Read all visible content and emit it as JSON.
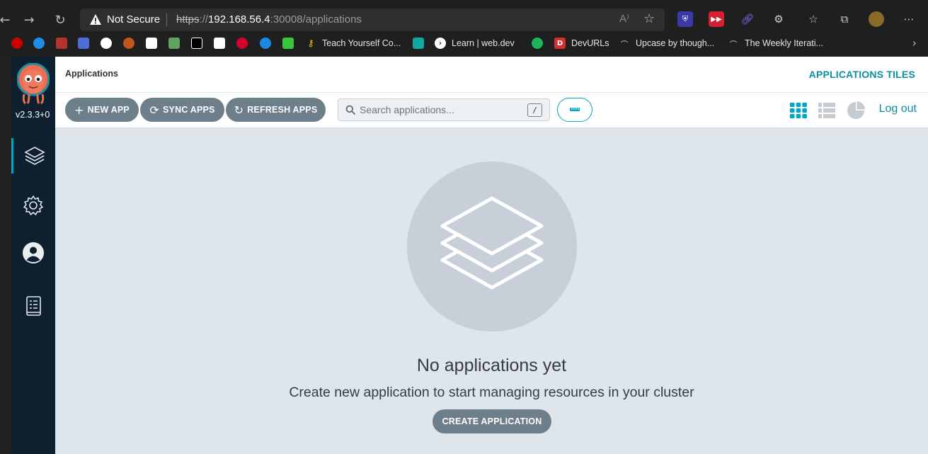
{
  "browser": {
    "security_label": "Not Secure",
    "url_scheme": "https",
    "url_sep": "://",
    "url_host": "192.168.56.4",
    "url_rest": ":30008/applications",
    "read_aloud_label": "A⁾",
    "bookmarks": [
      {
        "label": "Teach Yourself Co...",
        "icon": "key-icon"
      },
      {
        "label": "Learn  |  web.dev",
        "icon": "web-dev-icon"
      },
      {
        "label": "DevURLs",
        "icon": "devurls-icon"
      },
      {
        "label": "Upcase by though...",
        "icon": "upcase-icon"
      },
      {
        "label": "The Weekly Iterati...",
        "icon": "weekly-icon"
      }
    ],
    "devurls_letter": "D"
  },
  "sidebar": {
    "version": "v2.3.3+0",
    "items": [
      {
        "name": "applications",
        "icon": "layers-icon"
      },
      {
        "name": "settings",
        "icon": "gear-icon"
      },
      {
        "name": "user-info",
        "icon": "user-icon"
      },
      {
        "name": "documentation",
        "icon": "book-icon"
      }
    ]
  },
  "header": {
    "breadcrumb": "Applications",
    "view_title": "APPLICATIONS TILES"
  },
  "toolbar": {
    "new_app": "NEW APP",
    "sync_apps": "SYNC APPS",
    "refresh_apps": "REFRESH APPS",
    "search_placeholder": "Search applications...",
    "search_shortcut": "/",
    "logout": "Log out"
  },
  "empty_state": {
    "title": "No applications yet",
    "subtitle": "Create new application to start managing resources in your cluster",
    "button": "CREATE APPLICATION"
  },
  "colors": {
    "accent": "#0a8fa3",
    "button_bg": "#6d7f8b",
    "main_bg": "#dee6eb",
    "sidebar_bg": "#0e2030"
  }
}
